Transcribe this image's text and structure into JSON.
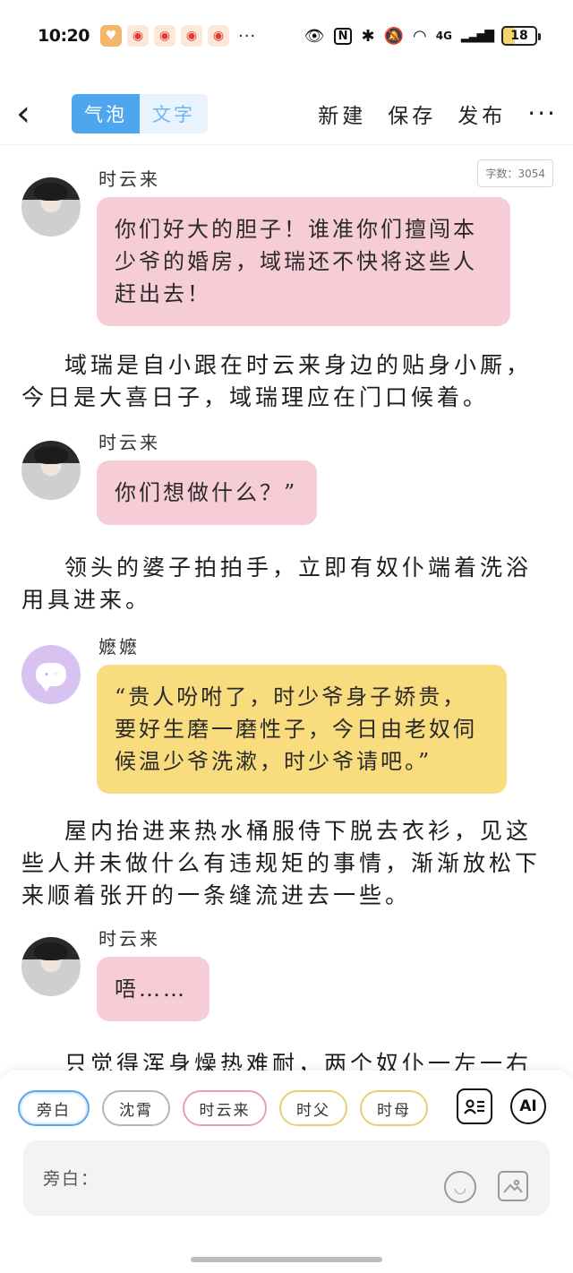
{
  "status_bar": {
    "time": "10:20",
    "battery": "18",
    "network": "4G",
    "apps": [
      "heart-app-icon",
      "weibo-icon",
      "weibo-icon",
      "weibo-icon",
      "weibo-icon"
    ],
    "more": "···"
  },
  "top_nav": {
    "tabs": [
      {
        "label": "气泡",
        "active": true
      },
      {
        "label": "文字",
        "active": false
      }
    ],
    "actions": {
      "new": "新建",
      "save": "保存",
      "publish": "发布"
    },
    "more": "···"
  },
  "word_count": "字数：3054",
  "story": [
    {
      "type": "msg",
      "speaker": "时云来",
      "text": "你们好大的胆子！谁准你们擅闯本少爷的婚房，域瑞还不快将这些人赶出去！",
      "color": "#f6ccd6"
    },
    {
      "type": "narration",
      "text": "域瑞是自小跟在时云来身边的贴身小厮，今日是大喜日子，域瑞理应在门口候着。"
    },
    {
      "type": "msg",
      "speaker": "时云来",
      "text": "你们想做什么？”",
      "color": "#f6ccd6"
    },
    {
      "type": "narration",
      "text": "领头的婆子拍拍手，立即有奴仆端着洗浴用具进来。"
    },
    {
      "type": "msg",
      "speaker": "嬷嬷",
      "text": "“贵人吩咐了，时少爷身子娇贵，要好生磨一磨性子，今日由老奴伺候温少爷洗漱，时少爷请吧。”",
      "color": "#f8dc7e"
    },
    {
      "type": "narration",
      "text": "屋内抬进来热水桶服侍下脱去衣衫，见这些人并未做什么有违规矩的事情，渐渐放松下来顺着张开的一条缝流进去一些。"
    },
    {
      "type": "msg",
      "speaker": "时云来",
      "text": "唔……",
      "color": "#f6ccd6"
    },
    {
      "type": "narration",
      "text": "只觉得浑身燥热难耐，两个奴仆一左一右将"
    }
  ],
  "characters": [
    {
      "label": "旁白",
      "color": "#5aa6ea",
      "selected": true
    },
    {
      "label": "沈霄",
      "color": "#b0b8c4"
    },
    {
      "label": "时云来",
      "color": "#e6a0b6"
    },
    {
      "label": "时父",
      "color": "#e8cf74"
    },
    {
      "label": "时母",
      "color": "#e8cf74"
    }
  ],
  "tools": {
    "ai": "AI"
  },
  "input": {
    "placeholder": "旁白："
  }
}
